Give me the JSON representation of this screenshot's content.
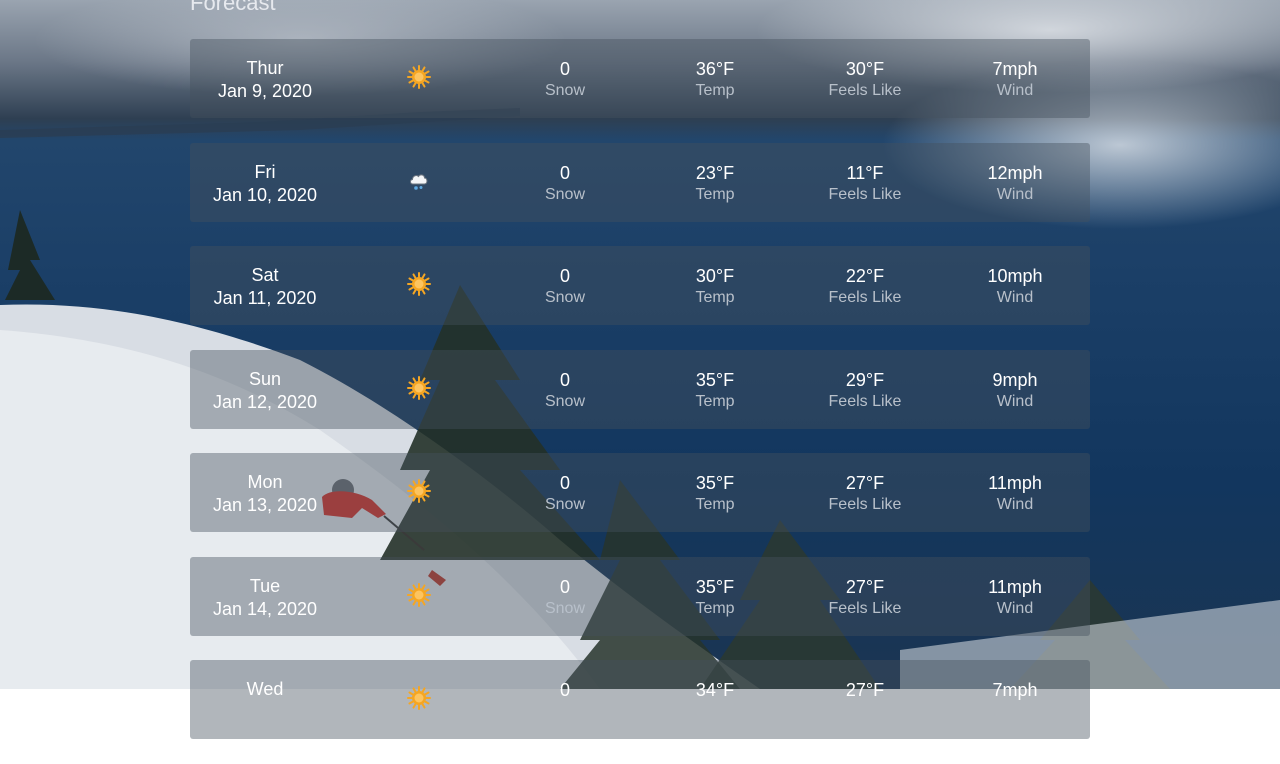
{
  "page": {
    "title": "Forecast"
  },
  "forecast": [
    {
      "day": "Thur",
      "date": "Jan 9, 2020",
      "icon": "sun-icon",
      "snow": "0",
      "snow_label": "Snow",
      "temp": "36°F",
      "temp_label": "Temp",
      "feels": "30°F",
      "feels_label": "Feels Like",
      "wind": "7mph",
      "wind_label": "Wind"
    },
    {
      "day": "Fri",
      "date": "Jan 10, 2020",
      "icon": "snow-cloud-icon",
      "snow": "0",
      "snow_label": "Snow",
      "temp": "23°F",
      "temp_label": "Temp",
      "feels": "11°F",
      "feels_label": "Feels Like",
      "wind": "12mph",
      "wind_label": "Wind"
    },
    {
      "day": "Sat",
      "date": "Jan 11, 2020",
      "icon": "sun-icon",
      "snow": "0",
      "snow_label": "Snow",
      "temp": "30°F",
      "temp_label": "Temp",
      "feels": "22°F",
      "feels_label": "Feels Like",
      "wind": "10mph",
      "wind_label": "Wind"
    },
    {
      "day": "Sun",
      "date": "Jan 12, 2020",
      "icon": "sun-icon",
      "snow": "0",
      "snow_label": "Snow",
      "temp": "35°F",
      "temp_label": "Temp",
      "feels": "29°F",
      "feels_label": "Feels Like",
      "wind": "9mph",
      "wind_label": "Wind"
    },
    {
      "day": "Mon",
      "date": "Jan 13, 2020",
      "icon": "sun-icon",
      "snow": "0",
      "snow_label": "Snow",
      "temp": "35°F",
      "temp_label": "Temp",
      "feels": "27°F",
      "feels_label": "Feels Like",
      "wind": "11mph",
      "wind_label": "Wind"
    },
    {
      "day": "Tue",
      "date": "Jan 14, 2020",
      "icon": "sun-icon",
      "snow": "0",
      "snow_label": "Snow",
      "temp": "35°F",
      "temp_label": "Temp",
      "feels": "27°F",
      "feels_label": "Feels Like",
      "wind": "11mph",
      "wind_label": "Wind"
    },
    {
      "day": "Wed",
      "date": "",
      "icon": "sun-icon",
      "snow": "0",
      "snow_label": "",
      "temp": "34°F",
      "temp_label": "",
      "feels": "27°F",
      "feels_label": "",
      "wind": "7mph",
      "wind_label": ""
    }
  ],
  "colors": {
    "row_background": "#46505c",
    "label_text": "#b8c0ca",
    "sun": "#f5a623",
    "lake": "#1b3f67"
  }
}
